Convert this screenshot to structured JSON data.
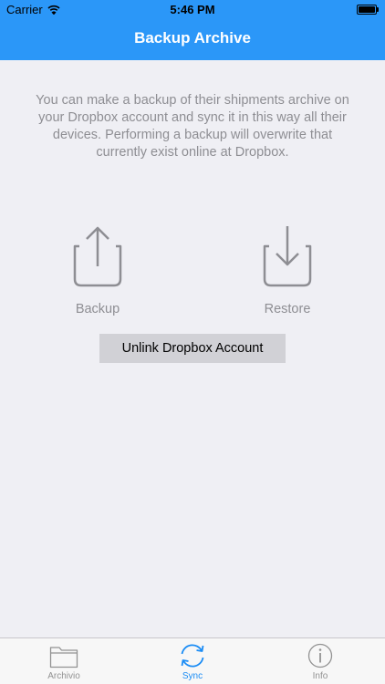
{
  "status_bar": {
    "carrier": "Carrier",
    "time": "5:46 PM"
  },
  "nav": {
    "title": "Backup Archive"
  },
  "main": {
    "description": "You can make a backup of their shipments archive on your Dropbox account and sync it in this way all their devices. Performing a backup will overwrite that currently exist online at Dropbox.",
    "actions": [
      {
        "label": "Backup",
        "icon": "upload-icon"
      },
      {
        "label": "Restore",
        "icon": "download-icon"
      }
    ],
    "unlink_button": "Unlink Dropbox Account"
  },
  "tabbar": {
    "tabs": [
      {
        "label": "Archivio",
        "icon": "folder-icon",
        "selected": false
      },
      {
        "label": "Sync",
        "icon": "sync-icon",
        "selected": true
      },
      {
        "label": "Info",
        "icon": "info-icon",
        "selected": false
      }
    ]
  },
  "colors": {
    "accent": "#2b97f8",
    "background": "#efeff4",
    "muted_text": "#8e8e93",
    "button_bg": "#d1d1d6",
    "tab_selected": "#1a8cf5",
    "tab_unselected": "#929292"
  }
}
